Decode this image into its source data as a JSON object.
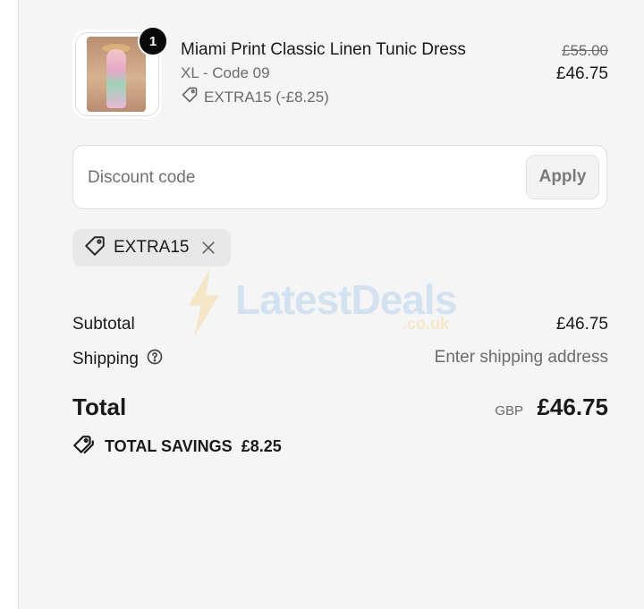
{
  "cart": {
    "item": {
      "quantity_badge": "1",
      "name": "Miami Print Classic Linen Tunic Dress",
      "variant": "XL - Code 09",
      "discount_line": "EXTRA15 (-£8.25)",
      "original_price": "£55.00",
      "price": "£46.75"
    }
  },
  "discount": {
    "placeholder": "Discount code",
    "apply_label": "Apply",
    "applied_code": "EXTRA15"
  },
  "watermark": {
    "brand": "LatestDeals",
    "suffix": ".co.uk"
  },
  "summary": {
    "subtotal_label": "Subtotal",
    "subtotal_value": "£46.75",
    "shipping_label": "Shipping",
    "shipping_value": "Enter shipping address",
    "total_label": "Total",
    "currency": "GBP",
    "total_value": "£46.75",
    "savings_label": "TOTAL SAVINGS",
    "savings_value": "£8.25"
  },
  "icons": {
    "tag": "tag-icon",
    "close": "close-icon",
    "help": "help-circle-icon",
    "savings": "tags-icon"
  }
}
